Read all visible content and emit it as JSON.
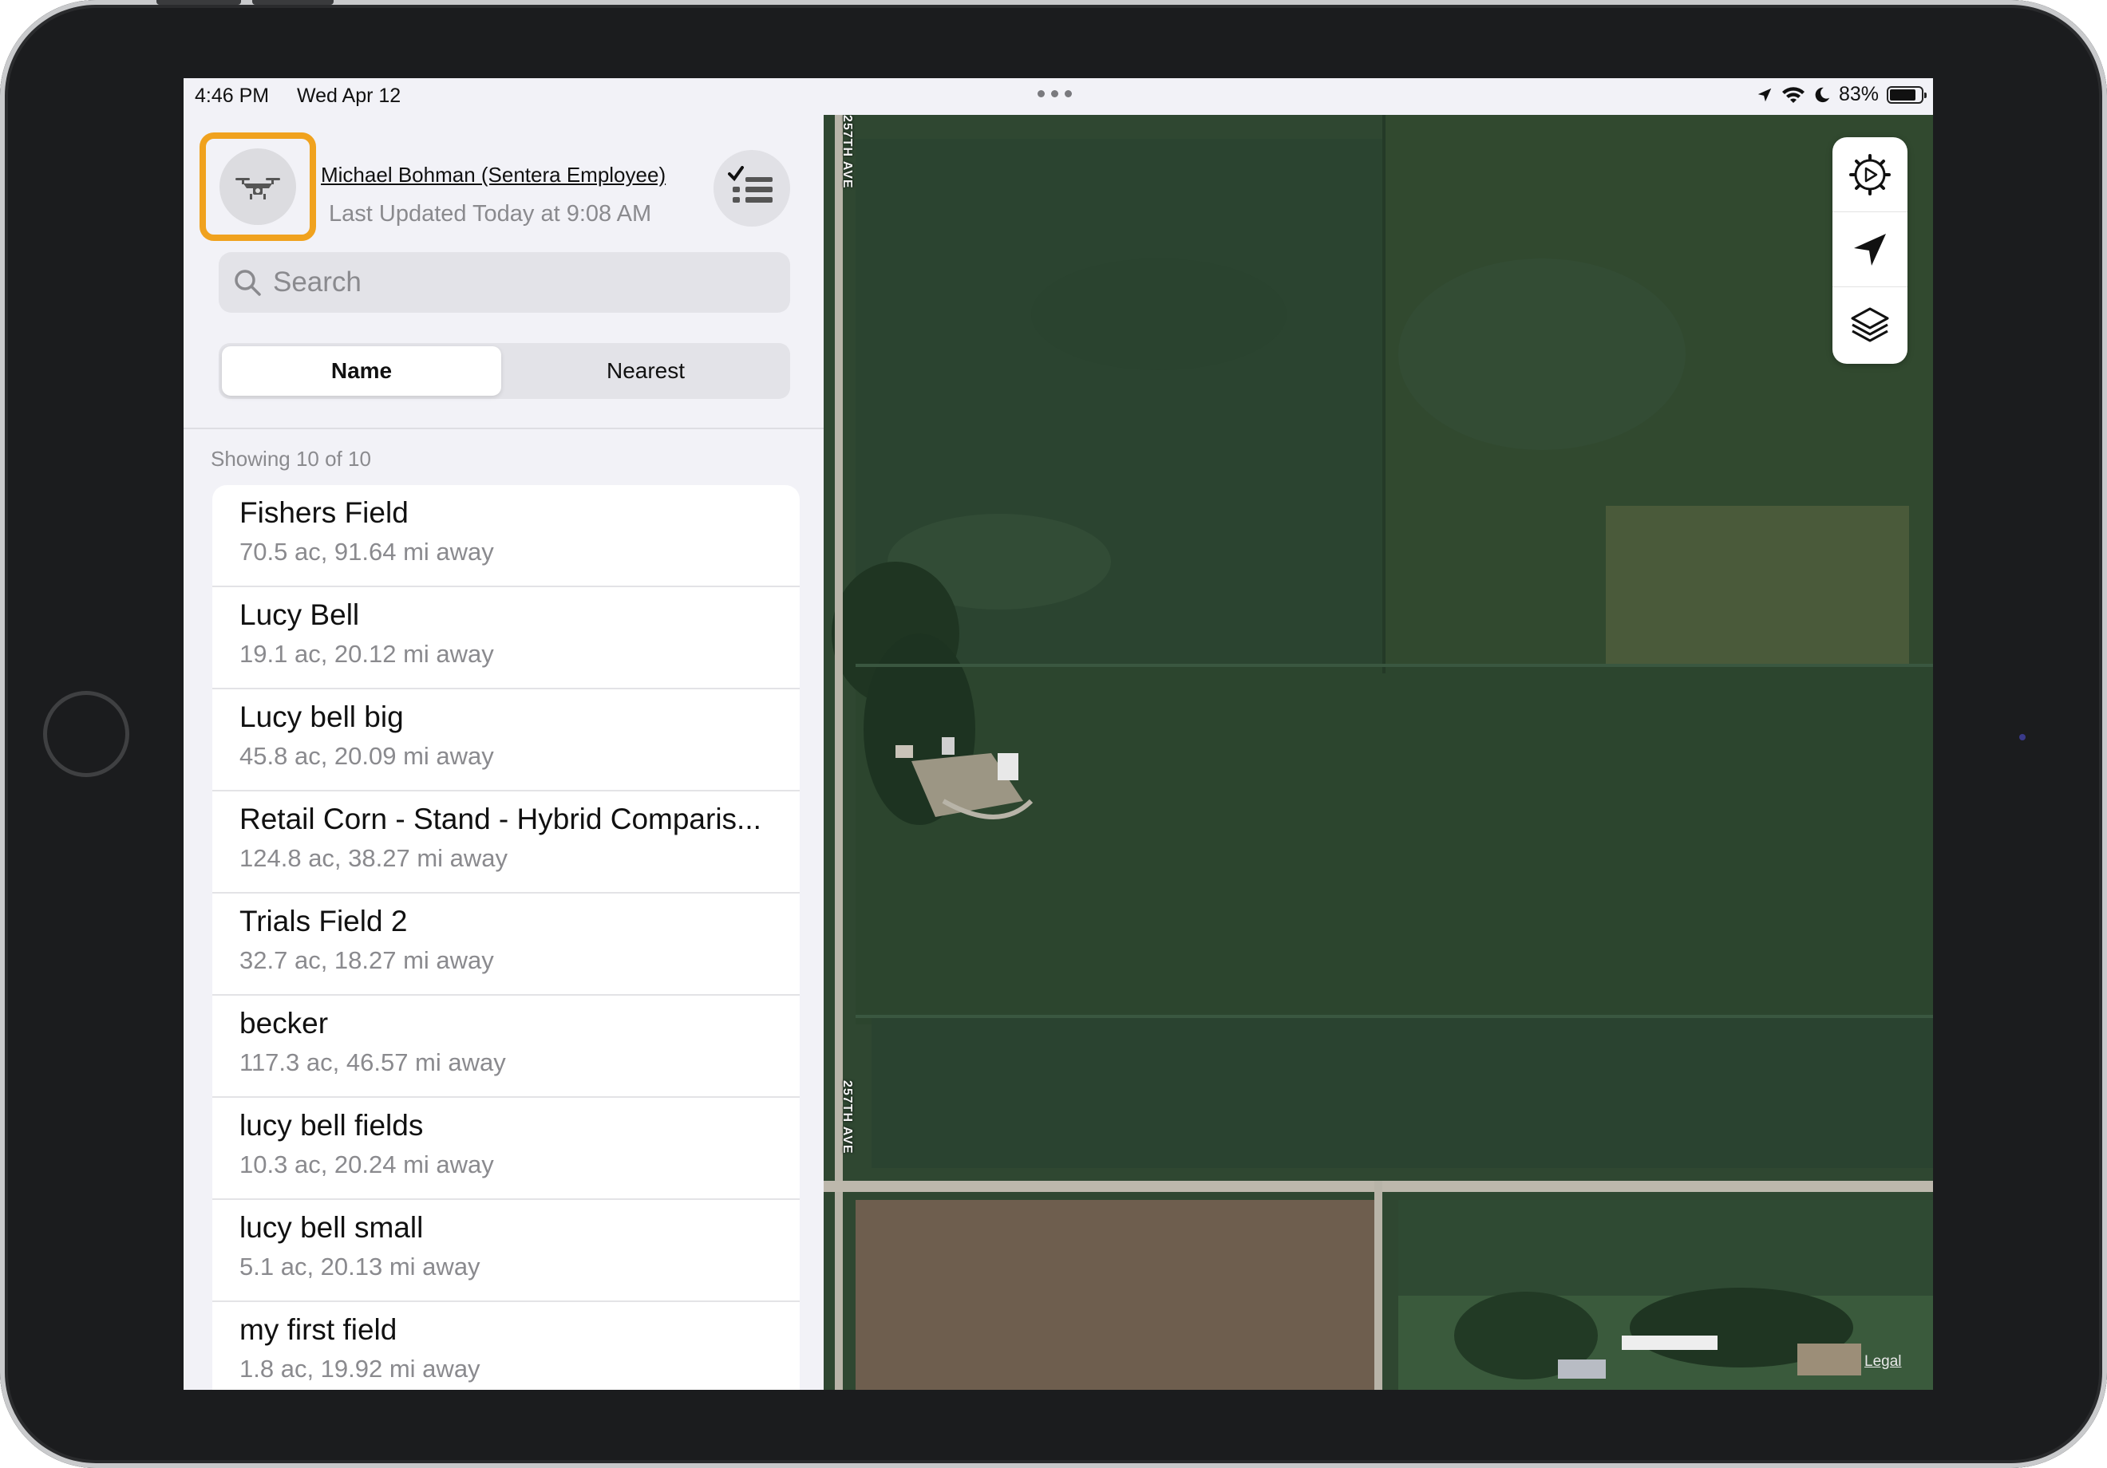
{
  "status_bar": {
    "time": "4:46 PM",
    "date": "Wed Apr 12",
    "battery_text": "83%",
    "battery_level": 0.83
  },
  "header": {
    "user_name": "Michael Bohman (Sentera Employee)",
    "last_updated": "Last Updated Today at 9:08 AM"
  },
  "search": {
    "placeholder": "Search"
  },
  "sort_tabs": {
    "name_label": "Name",
    "nearest_label": "Nearest",
    "selected": "Name"
  },
  "list_meta": {
    "showing": "Showing 10 of 10"
  },
  "fields": [
    {
      "name": "Fishers Field",
      "detail": "70.5 ac, 91.64 mi away"
    },
    {
      "name": "Lucy Bell",
      "detail": "19.1 ac, 20.12 mi away"
    },
    {
      "name": "Lucy bell big",
      "detail": "45.8 ac, 20.09 mi away"
    },
    {
      "name": "Retail Corn - Stand - Hybrid Comparis...",
      "detail": "124.8 ac, 38.27 mi away"
    },
    {
      "name": "Trials Field 2",
      "detail": "32.7 ac, 18.27 mi away"
    },
    {
      "name": "becker",
      "detail": "117.3 ac, 46.57 mi away"
    },
    {
      "name": "lucy bell fields",
      "detail": "10.3 ac, 20.24 mi away"
    },
    {
      "name": "lucy bell small",
      "detail": "5.1 ac, 20.13 mi away"
    },
    {
      "name": "my first field",
      "detail": "1.8 ac, 19.92 mi away"
    }
  ],
  "map": {
    "road_label_top": "257TH AVE",
    "road_label_bottom": "257TH AVE",
    "legal": "Legal",
    "controls": [
      "gear-play-icon",
      "location-arrow-icon",
      "layers-icon"
    ]
  },
  "colors": {
    "highlight": "#f0a21e",
    "map_base": "#2f4731"
  }
}
